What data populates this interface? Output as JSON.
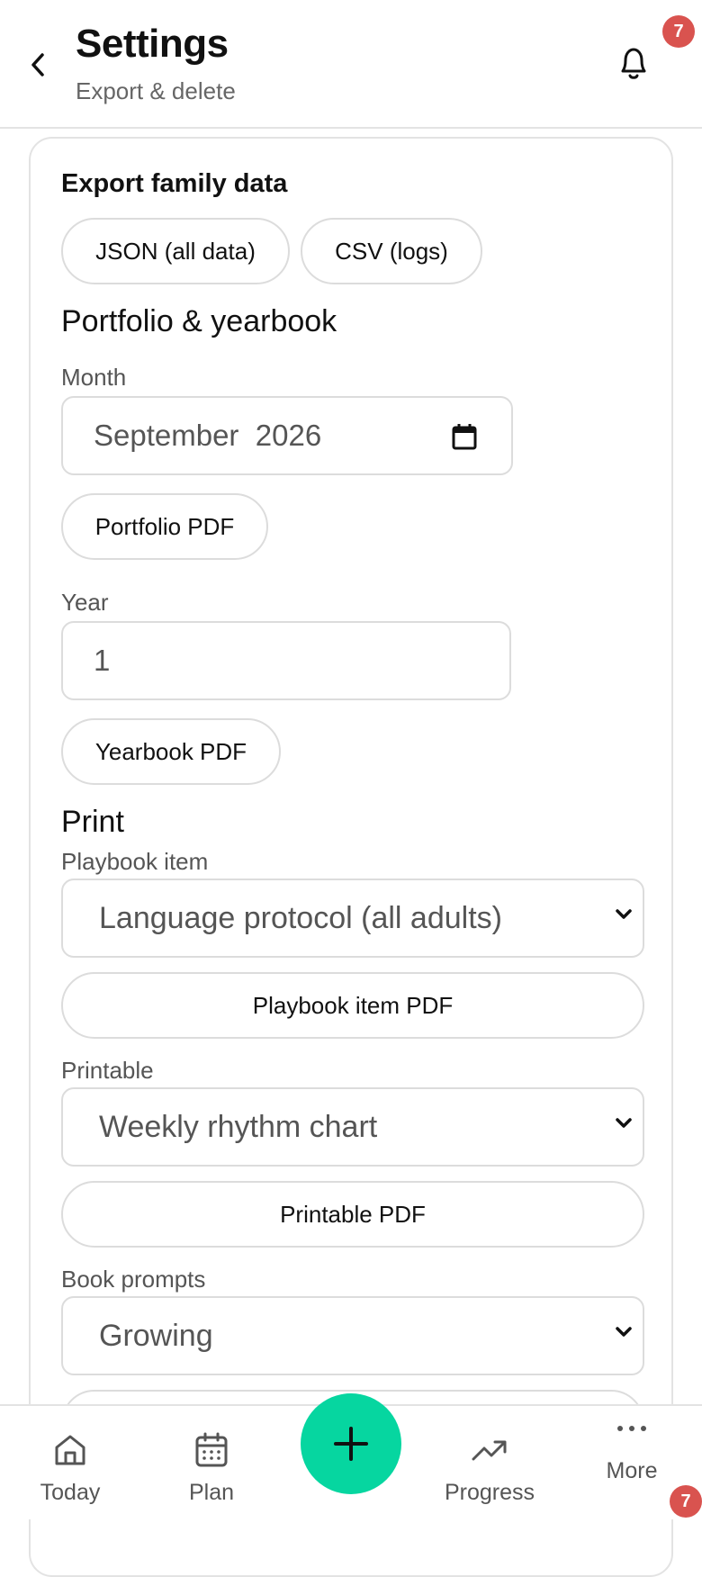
{
  "header": {
    "title": "Settings",
    "subtitle": "Export & delete",
    "notification_count": "7",
    "icons": {
      "back": "chevron-left-icon",
      "notifications": "bell-icon"
    }
  },
  "export": {
    "title": "Export family data",
    "json_button": "JSON (all data)",
    "csv_button": "CSV (logs)"
  },
  "portfolio": {
    "heading": "Portfolio & yearbook",
    "month_label": "Month",
    "month_value": "September  2026",
    "portfolio_button": "Portfolio PDF",
    "year_label": "Year",
    "year_value": "1",
    "yearbook_button": "Yearbook PDF"
  },
  "print": {
    "heading": "Print",
    "playbook_label": "Playbook item",
    "playbook_value": "Language protocol (all adults)",
    "playbook_button": "Playbook item PDF",
    "printable_label": "Printable",
    "printable_value": "Weekly rhythm chart",
    "printable_button": "Printable PDF",
    "prompts_label": "Book prompts",
    "prompts_value": "Growing"
  },
  "nav": {
    "items": [
      {
        "label": "Today",
        "icon": "home-icon"
      },
      {
        "label": "Plan",
        "icon": "calendar-icon"
      },
      {
        "label": "Progress",
        "icon": "trending-up-icon"
      },
      {
        "label": "More",
        "icon": "more-dots-icon"
      }
    ],
    "add_icon": "plus-icon",
    "more_badge": "7"
  },
  "colors": {
    "accent": "#06d6a0",
    "badge": "#d9534f",
    "border": "#dcdcdc"
  }
}
